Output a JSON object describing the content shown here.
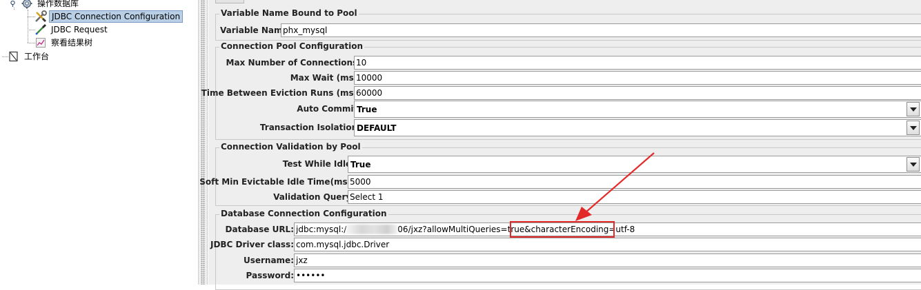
{
  "tree": {
    "items": [
      {
        "label": "操作数据库",
        "icon": "gear-icon"
      },
      {
        "label": "JDBC Connection Configuration",
        "icon": "wrench-screwdriver-icon",
        "selected": true
      },
      {
        "label": "JDBC Request",
        "icon": "pipette-icon"
      },
      {
        "label": "察看结果树",
        "icon": "chart-icon"
      },
      {
        "label": "工作台",
        "icon": "workbench-icon"
      }
    ]
  },
  "sections": {
    "variable": {
      "title": "Variable Name Bound to Pool",
      "variable_name_label": "Variable Name:",
      "variable_name_value": "phx_mysql"
    },
    "pool": {
      "title": "Connection Pool Configuration",
      "max_connections_label": "Max Number of Connections:",
      "max_connections_value": "10",
      "max_wait_label": "Max Wait (ms):",
      "max_wait_value": "10000",
      "eviction_label": "Time Between Eviction Runs (ms):",
      "eviction_value": "60000",
      "auto_commit_label": "Auto Commit:",
      "auto_commit_value": "True",
      "isolation_label": "Transaction Isolation:",
      "isolation_value": "DEFAULT"
    },
    "validation": {
      "title": "Connection Validation by Pool",
      "test_idle_label": "Test While Idle:",
      "test_idle_value": "True",
      "soft_min_label": "Soft Min Evictable Idle Time(ms):",
      "soft_min_value": "5000",
      "query_label": "Validation Query:",
      "query_value": "Select 1"
    },
    "database": {
      "title": "Database Connection Configuration",
      "url_label": "Database URL:",
      "url_prefix": "jdbc:mysql:/",
      "url_middle": "06/jxz?allowMultiQueries=true",
      "url_highlight": "&characterEncoding=utf-8",
      "driver_label": "JDBC Driver class:",
      "driver_value": "com.mysql.jdbc.Driver",
      "username_label": "Username:",
      "username_value": "jxz",
      "password_label": "Password:",
      "password_value": "••••••"
    }
  },
  "annotation": {
    "color": "#e32a2a"
  }
}
